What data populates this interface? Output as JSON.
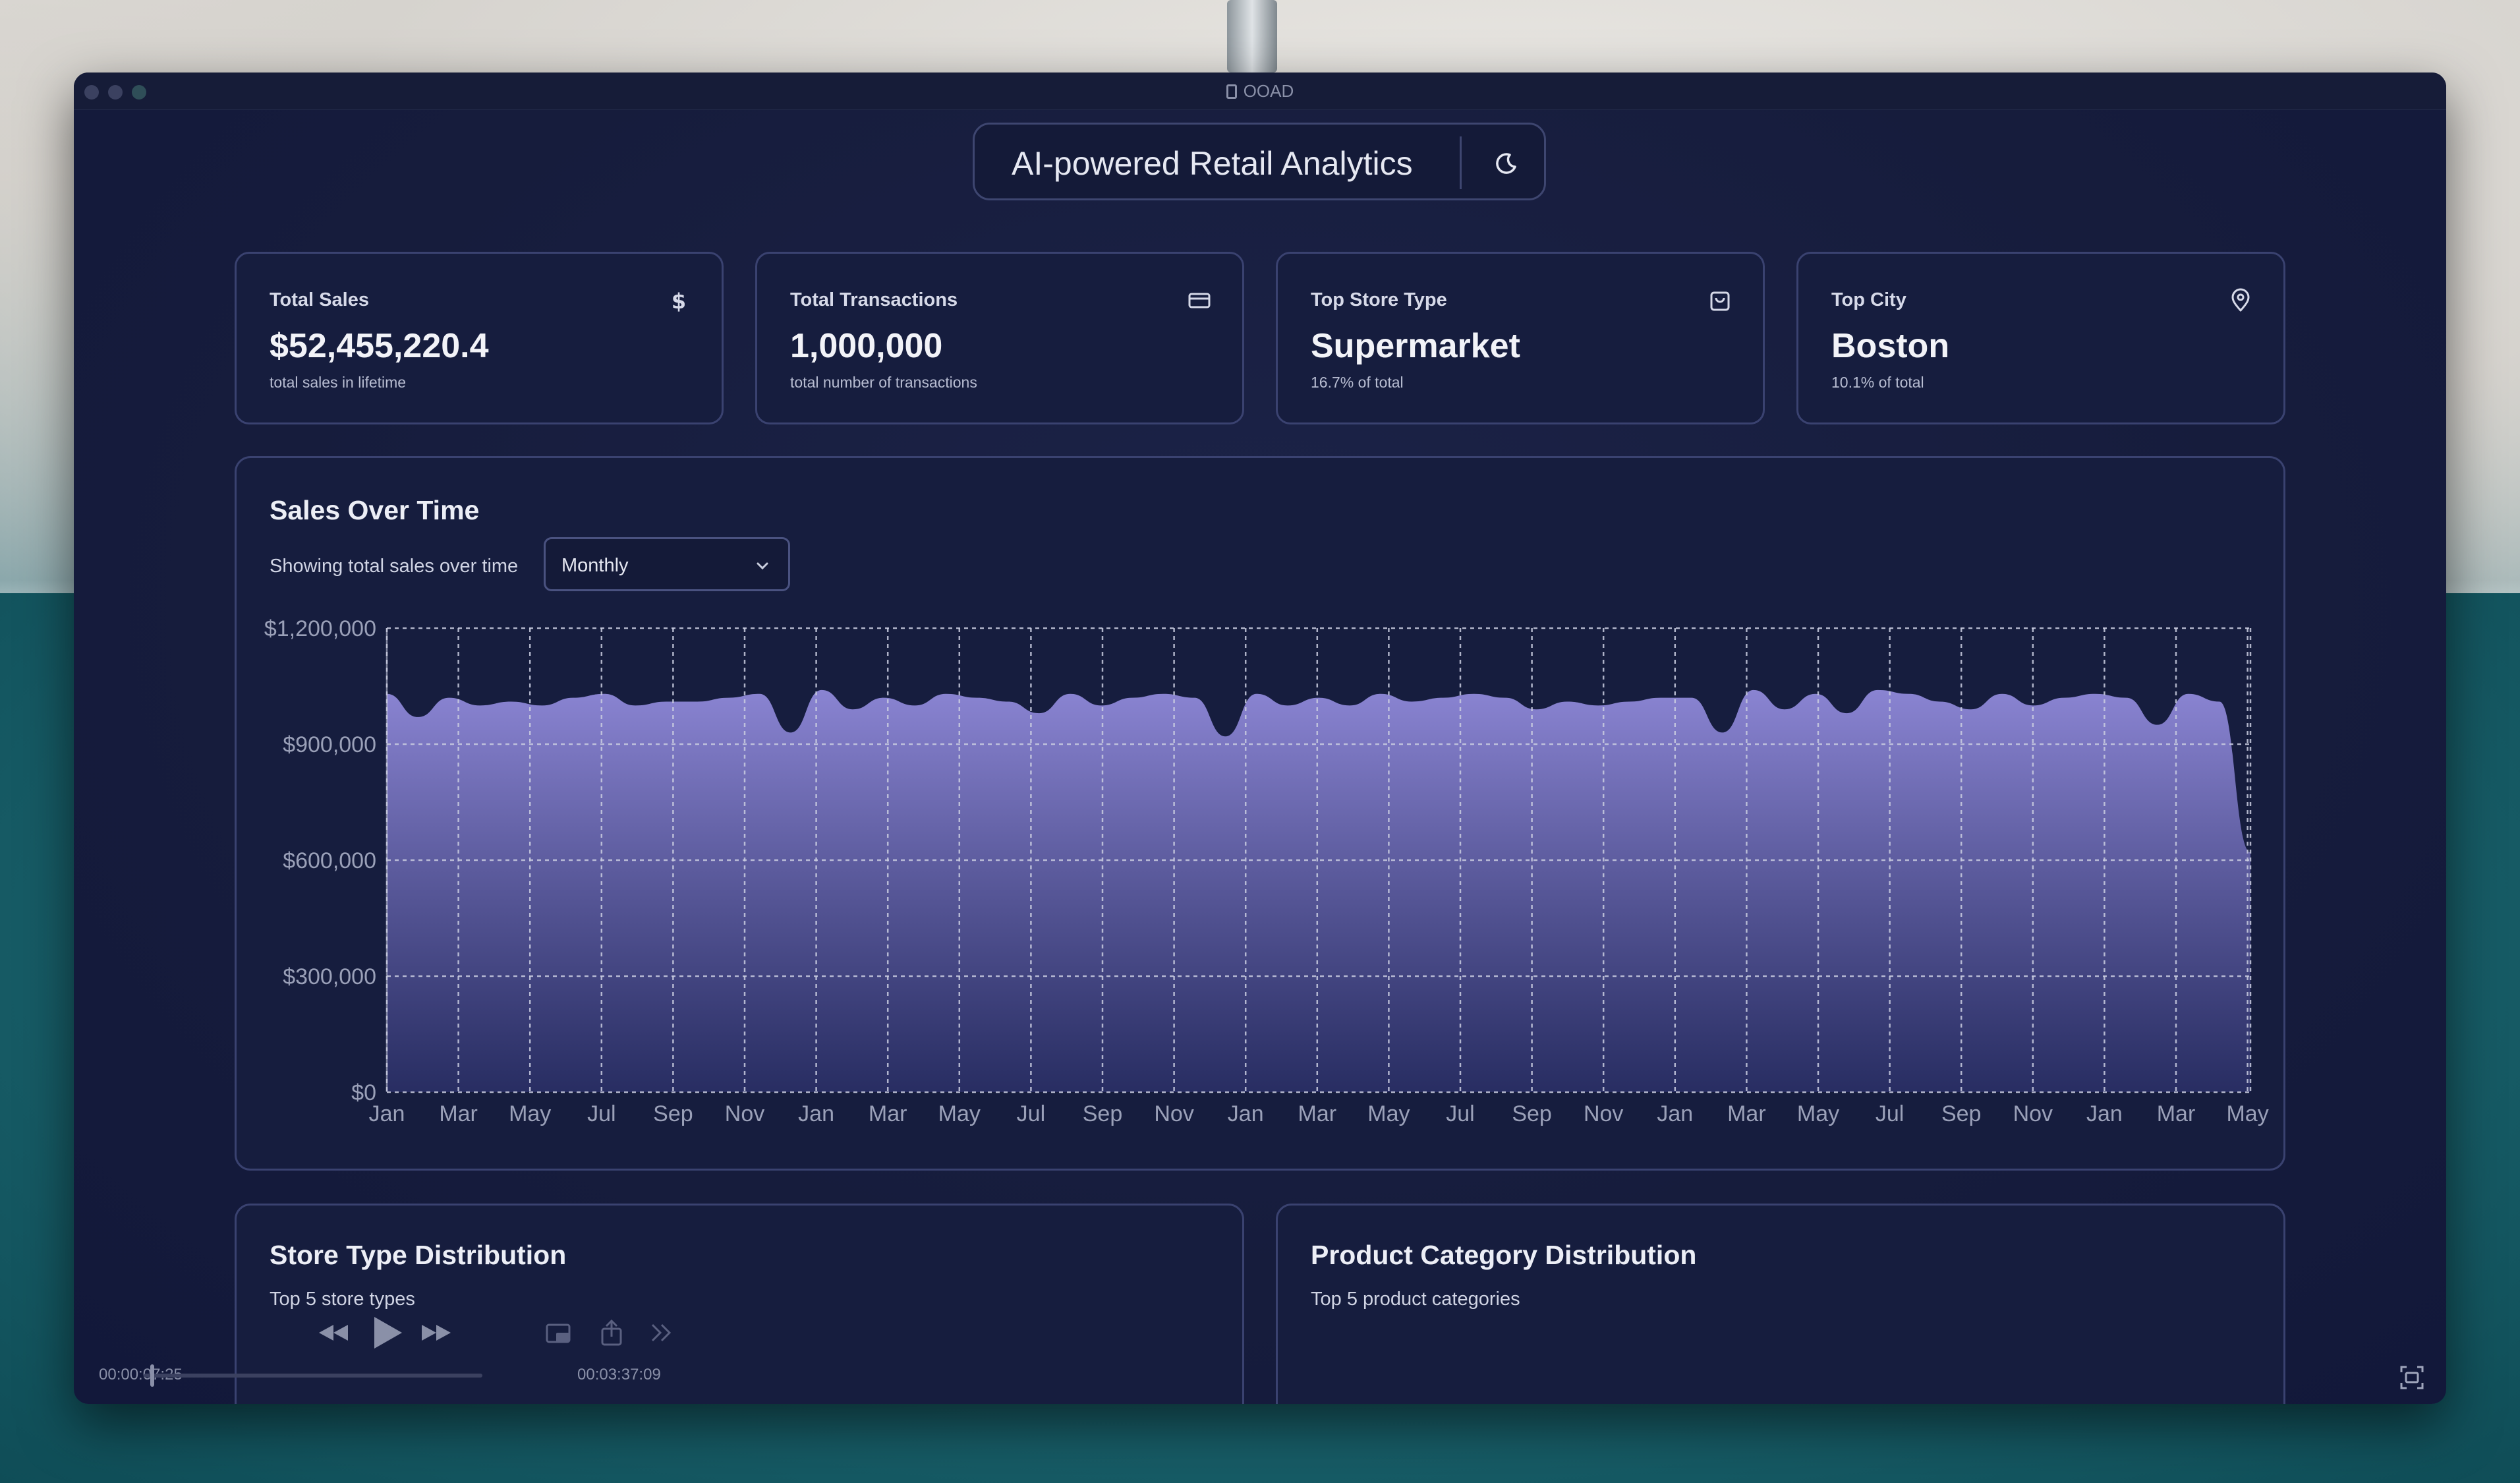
{
  "window": {
    "title": "OOAD"
  },
  "header": {
    "title": "AI-powered Retail Analytics",
    "theme_icon": "moon-icon"
  },
  "cards": [
    {
      "label": "Total Sales",
      "value": "$52,455,220.4",
      "sub": "total sales in lifetime",
      "icon": "dollar-icon"
    },
    {
      "label": "Total Transactions",
      "value": "1,000,000",
      "sub": "total number of transactions",
      "icon": "credit-card-icon"
    },
    {
      "label": "Top Store Type",
      "value": "Supermarket",
      "sub": "16.7% of total",
      "icon": "shopping-bag-icon"
    },
    {
      "label": "Top City",
      "value": "Boston",
      "sub": "10.1% of total",
      "icon": "map-pin-icon"
    }
  ],
  "sales_panel": {
    "title": "Sales Over Time",
    "subtitle": "Showing total sales over time",
    "granularity": "Monthly"
  },
  "store_panel": {
    "title": "Store Type Distribution",
    "subtitle": "Top 5 store types"
  },
  "category_panel": {
    "title": "Product Category Distribution",
    "subtitle": "Top 5 product categories"
  },
  "media": {
    "elapsed": "00:00:07:25",
    "duration": "00:03:37:09",
    "progress": 0.02
  },
  "colors": {
    "area_top": "#8a84d2",
    "area_bottom": "#2a2f66",
    "grid": "#c9cce0",
    "axis_text": "#9aa0b8"
  },
  "chart_data": {
    "type": "area",
    "ylim": [
      0,
      1200000
    ],
    "y_ticks": [
      0,
      300000,
      600000,
      900000,
      1200000
    ],
    "y_tick_labels": [
      "$0",
      "$300,000",
      "$600,000",
      "$900,000",
      "$1,200,000"
    ],
    "x_tick_labels": [
      "Jan",
      "Mar",
      "May",
      "Jul",
      "Sep",
      "Nov",
      "Jan",
      "Mar",
      "May",
      "Jul",
      "Sep",
      "Nov",
      "Jan",
      "Mar",
      "May",
      "Jul",
      "Sep",
      "Nov",
      "Jan",
      "Mar",
      "May",
      "Jul",
      "Sep",
      "Nov",
      "Jan",
      "Mar",
      "May"
    ],
    "grid": true,
    "series": [
      {
        "values": [
          1030000,
          970000,
          1020000,
          1000000,
          1010000,
          1000000,
          1020000,
          1030000,
          1000000,
          1010000,
          1010000,
          1020000,
          1030000,
          930000,
          1040000,
          990000,
          1020000,
          1000000,
          1030000,
          1020000,
          1010000,
          980000,
          1030000,
          1000000,
          1020000,
          1030000,
          1020000,
          920000,
          1030000,
          1000000,
          1020000,
          1000000,
          1030000,
          1010000,
          1020000,
          1030000,
          1020000,
          990000,
          1010000,
          1000000,
          1010000,
          1020000,
          1020000,
          930000,
          1040000,
          990000,
          1030000,
          980000,
          1040000,
          1030000,
          1010000,
          990000,
          1030000,
          1000000,
          1020000,
          1030000,
          1020000,
          950000,
          1030000,
          1010000,
          620000
        ]
      }
    ]
  }
}
